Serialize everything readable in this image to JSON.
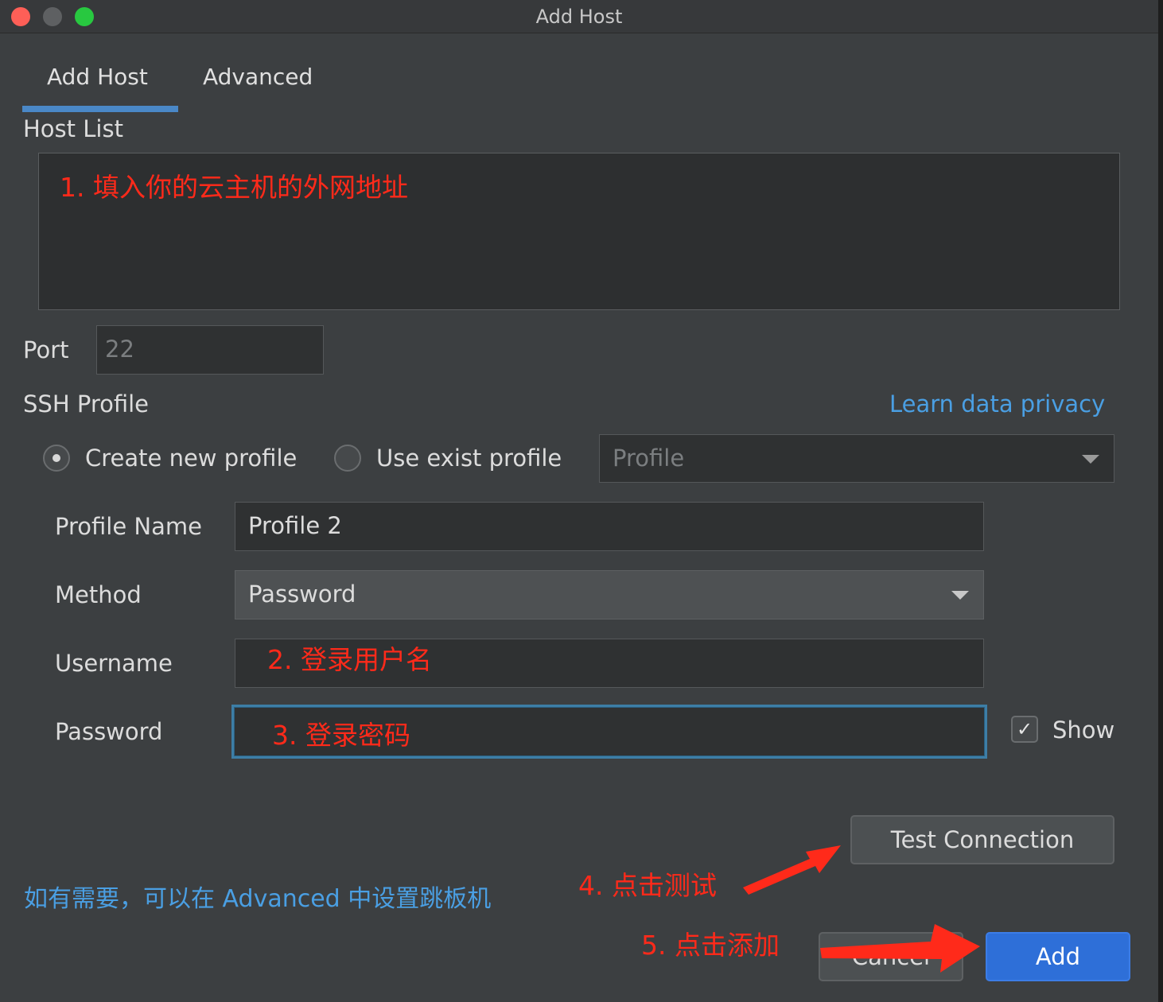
{
  "window": {
    "title": "Add Host"
  },
  "tabs": [
    {
      "label": "Add Host"
    },
    {
      "label": "Advanced"
    }
  ],
  "host_list": {
    "label": "Host List",
    "annotation": "1. 填入你的云主机的外网地址"
  },
  "port": {
    "label": "Port",
    "value": "22"
  },
  "ssh_profile": {
    "label": "SSH Profile",
    "privacy_link": "Learn data privacy",
    "options": [
      {
        "label": "Create new profile",
        "selected": true
      },
      {
        "label": "Use exist profile",
        "selected": false
      }
    ],
    "profile_select_placeholder": "Profile"
  },
  "form": {
    "profile_name": {
      "label": "Profile Name",
      "value": "Profile 2"
    },
    "method": {
      "label": "Method",
      "value": "Password"
    },
    "username": {
      "label": "Username",
      "annotation": "2. 登录用户名"
    },
    "password": {
      "label": "Password",
      "annotation": "3. 登录密码",
      "show_label": "Show",
      "show_checked": true
    }
  },
  "buttons": {
    "test_connection": "Test Connection",
    "cancel": "Cancel",
    "add": "Add"
  },
  "annotations": {
    "click_test": "4. 点击测试",
    "click_add": "5. 点击添加",
    "jump_host_note": "如有需要，可以在 Advanced 中设置跳板机"
  },
  "colors": {
    "annotation": "#ff2a1a",
    "accent": "#4a88c7",
    "link": "#4a9fe3",
    "primary_button": "#2e6fd8"
  }
}
